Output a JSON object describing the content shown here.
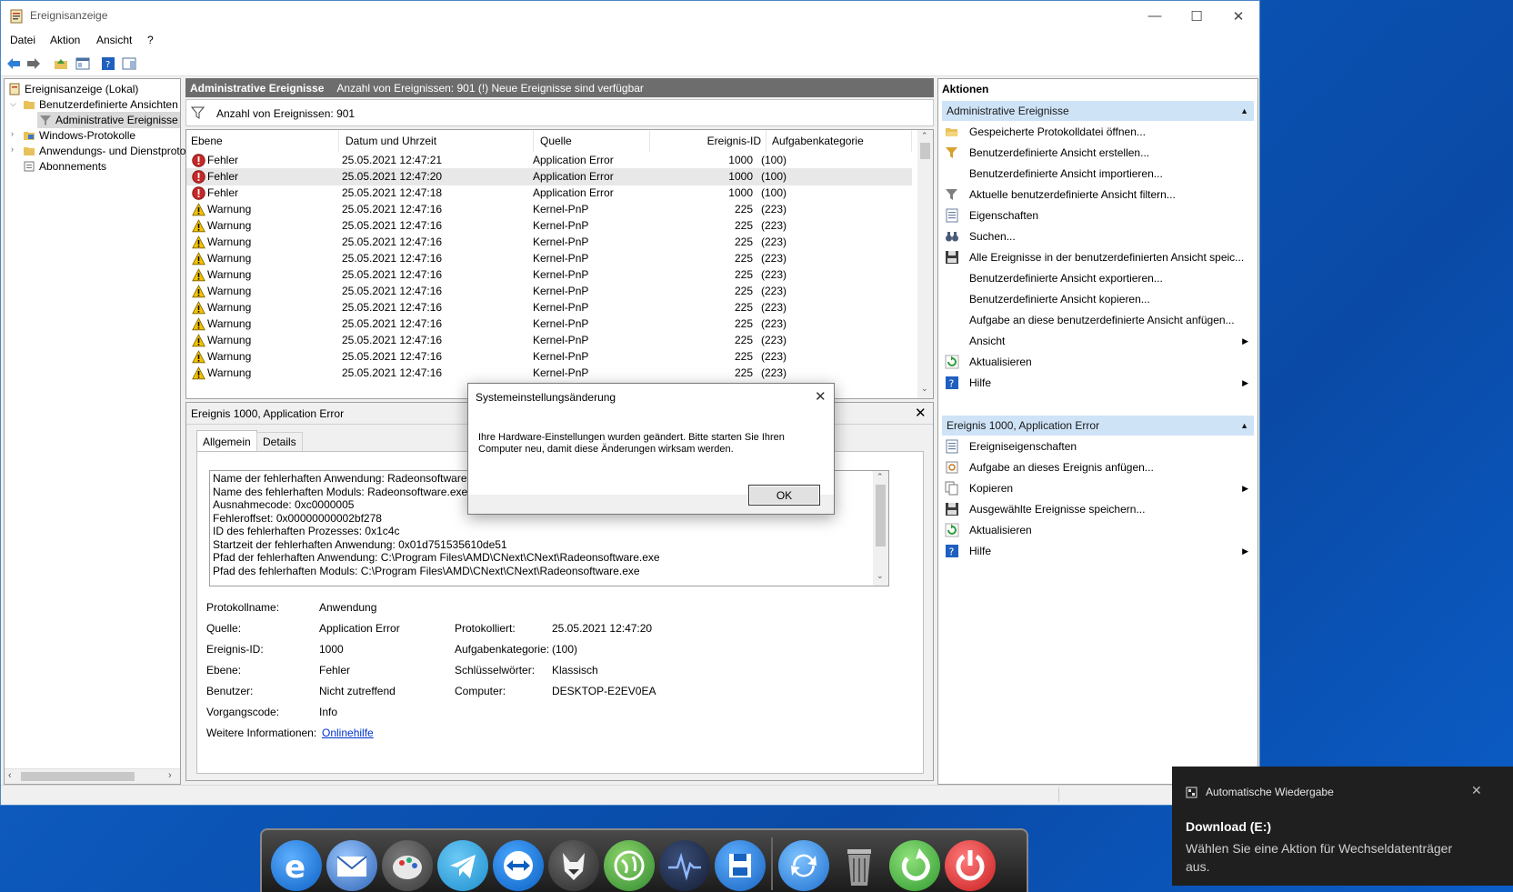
{
  "window": {
    "title": "Ereignisanzeige",
    "minimize": "—",
    "maximize": "☐",
    "close": "✕"
  },
  "menu": [
    "Datei",
    "Aktion",
    "Ansicht",
    "?"
  ],
  "tree": {
    "items": [
      {
        "label": "Ereignisanzeige (Lokal)"
      },
      {
        "label": "Benutzerdefinierte Ansichten"
      },
      {
        "label": "Administrative Ereignisse"
      },
      {
        "label": "Windows-Protokolle"
      },
      {
        "label": "Anwendungs- und Dienstprotokolle"
      },
      {
        "label": "Abonnements"
      }
    ]
  },
  "center": {
    "header_title": "Administrative Ereignisse",
    "header_info": "Anzahl von Ereignissen: 901 (!) Neue Ereignisse sind verfügbar",
    "filter_text": "Anzahl von Ereignissen: 901"
  },
  "grid": {
    "columns": [
      "Ebene",
      "Datum und Uhrzeit",
      "Quelle",
      "Ereignis-ID",
      "Aufgabenkategorie"
    ],
    "rows": [
      {
        "level": "Fehler",
        "icon": "error-icon",
        "date": "25.05.2021 12:47:21",
        "source": "Application Error",
        "id": "1000",
        "cat": "(100)"
      },
      {
        "level": "Fehler",
        "icon": "error-icon",
        "date": "25.05.2021 12:47:20",
        "source": "Application Error",
        "id": "1000",
        "cat": "(100)"
      },
      {
        "level": "Fehler",
        "icon": "error-icon",
        "date": "25.05.2021 12:47:18",
        "source": "Application Error",
        "id": "1000",
        "cat": "(100)"
      },
      {
        "level": "Warnung",
        "icon": "warning-icon",
        "date": "25.05.2021 12:47:16",
        "source": "Kernel-PnP",
        "id": "225",
        "cat": "(223)"
      },
      {
        "level": "Warnung",
        "icon": "warning-icon",
        "date": "25.05.2021 12:47:16",
        "source": "Kernel-PnP",
        "id": "225",
        "cat": "(223)"
      },
      {
        "level": "Warnung",
        "icon": "warning-icon",
        "date": "25.05.2021 12:47:16",
        "source": "Kernel-PnP",
        "id": "225",
        "cat": "(223)"
      },
      {
        "level": "Warnung",
        "icon": "warning-icon",
        "date": "25.05.2021 12:47:16",
        "source": "Kernel-PnP",
        "id": "225",
        "cat": "(223)"
      },
      {
        "level": "Warnung",
        "icon": "warning-icon",
        "date": "25.05.2021 12:47:16",
        "source": "Kernel-PnP",
        "id": "225",
        "cat": "(223)"
      },
      {
        "level": "Warnung",
        "icon": "warning-icon",
        "date": "25.05.2021 12:47:16",
        "source": "Kernel-PnP",
        "id": "225",
        "cat": "(223)"
      },
      {
        "level": "Warnung",
        "icon": "warning-icon",
        "date": "25.05.2021 12:47:16",
        "source": "Kernel-PnP",
        "id": "225",
        "cat": "(223)"
      },
      {
        "level": "Warnung",
        "icon": "warning-icon",
        "date": "25.05.2021 12:47:16",
        "source": "Kernel-PnP",
        "id": "225",
        "cat": "(223)"
      },
      {
        "level": "Warnung",
        "icon": "warning-icon",
        "date": "25.05.2021 12:47:16",
        "source": "Kernel-PnP",
        "id": "225",
        "cat": "(223)"
      },
      {
        "level": "Warnung",
        "icon": "warning-icon",
        "date": "25.05.2021 12:47:16",
        "source": "Kernel-PnP",
        "id": "225",
        "cat": "(223)"
      },
      {
        "level": "Warnung",
        "icon": "warning-icon",
        "date": "25.05.2021 12:47:16",
        "source": "Kernel-PnP",
        "id": "225",
        "cat": "(223)"
      }
    ]
  },
  "detail": {
    "title": "Ereignis 1000, Application Error",
    "tab_general": "Allgemein",
    "tab_details": "Details",
    "description": [
      "Name der fehlerhaften Anwendung: Radeonsoftware.e",
      "Name des fehlerhaften Moduls: Radeonsoftware.exe, V",
      "Ausnahmecode: 0xc0000005",
      "Fehleroffset: 0x00000000002bf278",
      "ID des fehlerhaften Prozesses: 0x1c4c",
      "Startzeit der fehlerhaften Anwendung: 0x01d751535610de51",
      "Pfad der fehlerhaften Anwendung: C:\\Program Files\\AMD\\CNext\\CNext\\Radeonsoftware.exe",
      "Pfad des fehlerhaften Moduls: C:\\Program Files\\AMD\\CNext\\CNext\\Radeonsoftware.exe"
    ],
    "props": {
      "log_name_label": "Protokollname:",
      "log_name": "Anwendung",
      "source_label": "Quelle:",
      "source": "Application Error",
      "logged_label": "Protokolliert:",
      "logged": "25.05.2021 12:47:20",
      "event_id_label": "Ereignis-ID:",
      "event_id": "1000",
      "task_cat_label": "Aufgabenkategorie:",
      "task_cat": "(100)",
      "level_label": "Ebene:",
      "level": "Fehler",
      "keywords_label": "Schlüsselwörter:",
      "keywords": "Klassisch",
      "user_label": "Benutzer:",
      "user": "Nicht zutreffend",
      "computer_label": "Computer:",
      "computer": "DESKTOP-E2EV0EA",
      "opcode_label": "Vorgangscode:",
      "opcode": "Info",
      "more_info_label": "Weitere Informationen:",
      "more_info_link": "Onlinehilfe"
    }
  },
  "actions": {
    "title": "Aktionen",
    "section1": "Administrative Ereignisse",
    "items1": [
      {
        "label": "Gespeicherte Protokolldatei öffnen...",
        "icon": "folder-open-icon"
      },
      {
        "label": "Benutzerdefinierte Ansicht erstellen...",
        "icon": "filter-create-icon"
      },
      {
        "label": "Benutzerdefinierte Ansicht importieren...",
        "icon": ""
      },
      {
        "label": "Aktuelle benutzerdefinierte Ansicht filtern...",
        "icon": "filter-icon"
      },
      {
        "label": "Eigenschaften",
        "icon": "properties-icon"
      },
      {
        "label": "Suchen...",
        "icon": "binoculars-icon"
      },
      {
        "label": "Alle Ereignisse in der benutzerdefinierten Ansicht speic...",
        "icon": "save-icon"
      },
      {
        "label": "Benutzerdefinierte Ansicht exportieren...",
        "icon": ""
      },
      {
        "label": "Benutzerdefinierte Ansicht kopieren...",
        "icon": ""
      },
      {
        "label": "Aufgabe an diese benutzerdefinierte Ansicht anfügen...",
        "icon": ""
      },
      {
        "label": "Ansicht",
        "icon": "",
        "sub": true
      },
      {
        "label": "Aktualisieren",
        "icon": "refresh-icon"
      },
      {
        "label": "Hilfe",
        "icon": "help-icon",
        "sub": true
      }
    ],
    "section2": "Ereignis 1000, Application Error",
    "items2": [
      {
        "label": "Ereigniseigenschaften",
        "icon": "properties-icon"
      },
      {
        "label": "Aufgabe an dieses Ereignis anfügen...",
        "icon": "task-icon"
      },
      {
        "label": "Kopieren",
        "icon": "copy-icon",
        "sub": true
      },
      {
        "label": "Ausgewählte Ereignisse speichern...",
        "icon": "save-icon"
      },
      {
        "label": "Aktualisieren",
        "icon": "refresh-icon"
      },
      {
        "label": "Hilfe",
        "icon": "help-icon",
        "sub": true
      }
    ]
  },
  "dialog": {
    "title": "Systemeinstellungsänderung",
    "message_line1": "Ihre Hardware-Einstellungen wurden geändert. Bitte starten Sie Ihren",
    "message_line2": "Computer neu, damit diese Änderungen wirksam werden.",
    "ok": "OK"
  },
  "toast": {
    "app": "Automatische Wiedergabe",
    "title": "Download (E:)",
    "body_line1": "Wählen Sie eine Aktion für Wechseldatenträger",
    "body_line2": "aus."
  },
  "dock": {
    "icons": [
      "edge-icon",
      "mail-icon",
      "paint-icon",
      "telegram-icon",
      "teamviewer-icon",
      "fox-icon",
      "globe-icon",
      "audio-wave-icon",
      "floppy-icon",
      "sync-icon",
      "trash-icon",
      "restart-icon",
      "power-icon"
    ]
  },
  "colors": {
    "accent": "#cfe3f7",
    "header_grey": "#6d6d6d",
    "error": "#c62828",
    "warning": "#f2c200",
    "link": "#0033cc"
  }
}
